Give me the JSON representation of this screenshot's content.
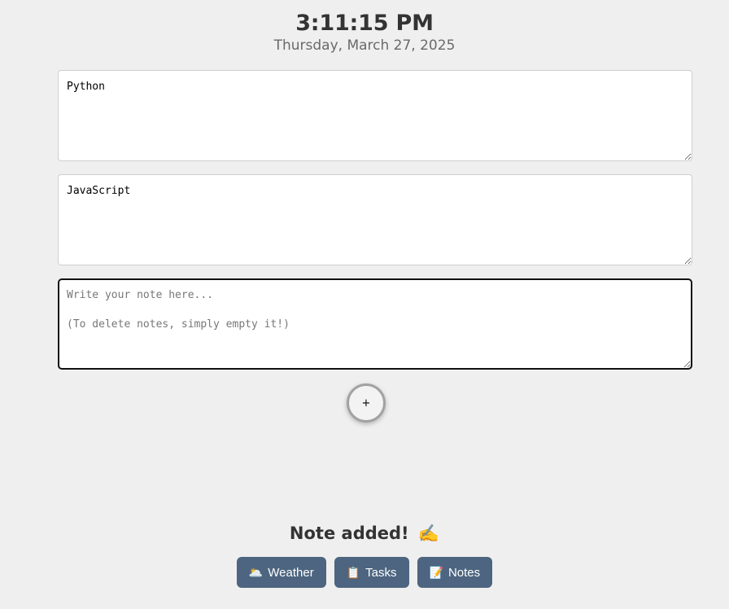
{
  "header": {
    "time": "3:11:15 PM",
    "date": "Thursday, March 27, 2025"
  },
  "notes": [
    {
      "value": "Python"
    },
    {
      "value": "JavaScript"
    },
    {
      "value": "",
      "placeholder": "Write your note here...\n\n(To delete notes, simply empty it!)"
    }
  ],
  "add_button": {
    "label": "+"
  },
  "status": {
    "text": "Note added!",
    "emoji": "✍️"
  },
  "nav": {
    "weather": {
      "icon": "🌥️",
      "label": "Weather"
    },
    "tasks": {
      "icon": "📋",
      "label": "Tasks"
    },
    "notes": {
      "icon": "📝",
      "label": "Notes"
    }
  }
}
